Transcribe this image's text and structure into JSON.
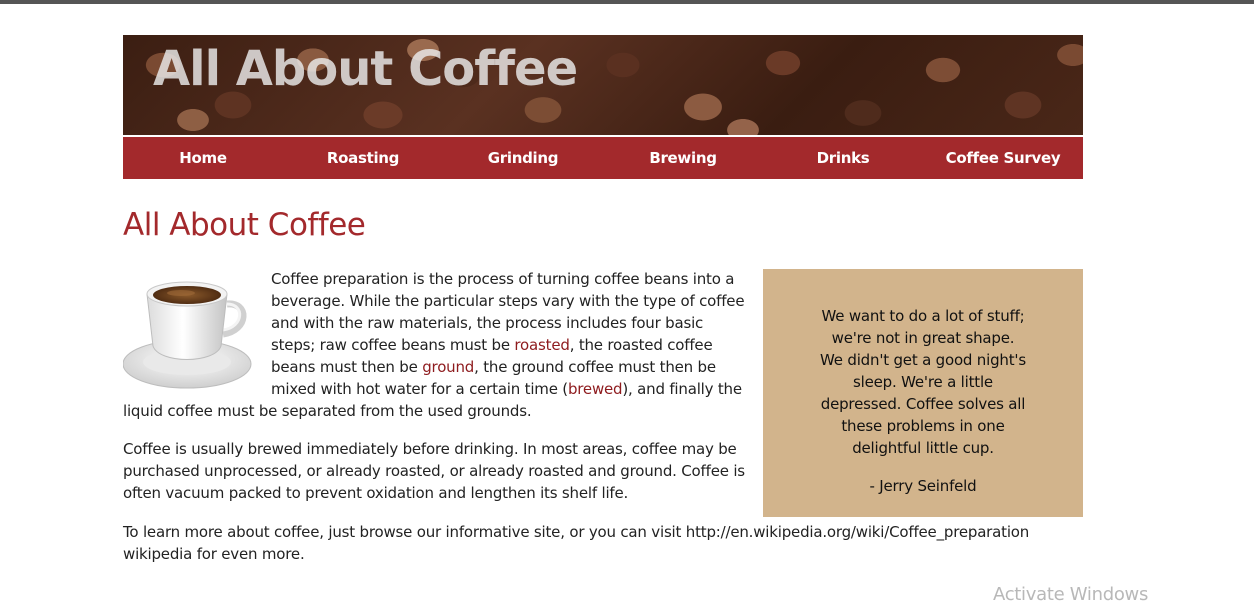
{
  "header": {
    "banner_title": "All About Coffee"
  },
  "nav": {
    "items": [
      {
        "label": "Home"
      },
      {
        "label": "Roasting"
      },
      {
        "label": "Grinding"
      },
      {
        "label": "Brewing"
      },
      {
        "label": "Drinks"
      },
      {
        "label": "Coffee Survey"
      }
    ]
  },
  "main": {
    "title": "All About Coffee",
    "image_icon": "coffee-cup-icon",
    "para1": {
      "t1": "Coffee preparation is the process of turning coffee beans into a beverage. While the particular steps vary with the type of coffee and with the raw materials, the process includes four basic steps; raw coffee beans must be ",
      "link_roasted": "roasted",
      "t2": ", the roasted coffee beans must then be ",
      "link_ground": "ground",
      "t3": ", the ground coffee must then be mixed with hot water for a certain time (",
      "link_brewed": "brewed",
      "t4": "), and finally the liquid coffee must be separated from the used grounds."
    },
    "para2": "Coffee is usually brewed immediately before drinking. In most areas, coffee may be purchased unprocessed, or already roasted, or already roasted and ground. Coffee is often vacuum packed to prevent oxidation and lengthen its shelf life.",
    "para3": "To learn more about coffee, just browse our informative site, or you can visit http://en.wikipedia.org/wiki/Coffee_preparation wikipedia for even more."
  },
  "quote": {
    "text": "We want to do a lot of stuff; we're not in great shape. We didn't get a good night's sleep. We're a little depressed. Coffee solves all these problems in one delightful little cup.",
    "author": "- Jerry Seinfeld"
  },
  "watermark": "Activate Windows",
  "colors": {
    "accent": "#a3292c",
    "quote_bg": "#d2b48c",
    "link": "#8e1b1e"
  }
}
